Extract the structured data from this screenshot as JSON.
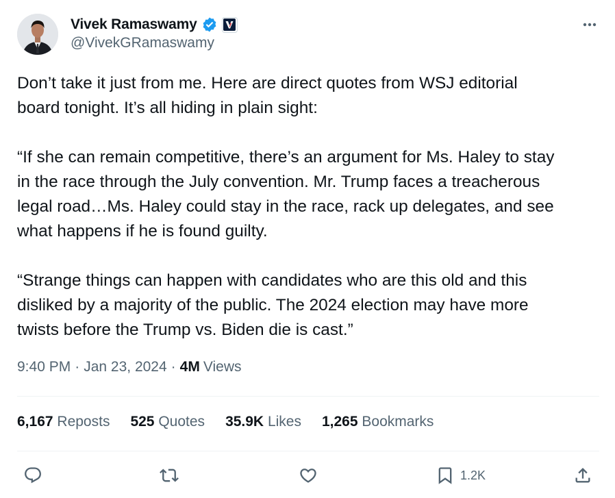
{
  "author": {
    "name": "Vivek Ramaswamy",
    "handle": "@VivekGRamaswamy"
  },
  "tweet": {
    "paragraphs": [
      [
        "Don’t take it just from me. Here are direct quotes from WSJ editorial",
        "board tonight. It’s all hiding in plain sight:"
      ],
      [
        "“If she can remain competitive, there’s an argument for Ms. Haley to stay",
        "in the race through the July convention. Mr. Trump faces a treacherous",
        "legal road…Ms. Haley could stay in the race, rack up delegates, and see",
        "what happens if he is found guilty."
      ],
      [
        "“Strange things can happen with candidates who are this old and this",
        "disliked by a majority of the public. The 2024 election may have more",
        "twists before the Trump vs. Biden die is cast.”"
      ]
    ]
  },
  "meta": {
    "time": "9:40 PM",
    "separator": "·",
    "date": "Jan 23, 2024",
    "views_count": "4M",
    "views_label": "Views"
  },
  "stats": {
    "reposts": {
      "num": "6,167",
      "label": "Reposts"
    },
    "quotes": {
      "num": "525",
      "label": "Quotes"
    },
    "likes": {
      "num": "35.9K",
      "label": "Likes"
    },
    "bookmarks": {
      "num": "1,265",
      "label": "Bookmarks"
    }
  },
  "actions": {
    "bookmark_count": "1.2K"
  },
  "colors": {
    "text": "#0f1419",
    "secondary": "#536471",
    "verified": "#1d9bf0",
    "divider": "#eff3f4"
  },
  "icons": [
    "verified-badge-icon",
    "affiliate-badge-icon",
    "more-icon",
    "reply-icon",
    "repost-icon",
    "like-icon",
    "bookmark-icon",
    "share-icon"
  ]
}
